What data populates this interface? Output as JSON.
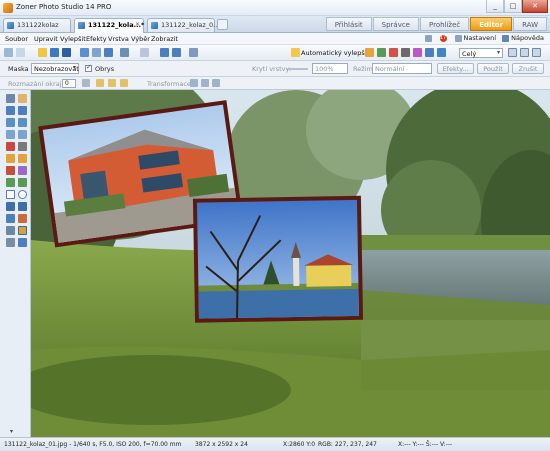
{
  "window": {
    "title": "Zoner Photo Studio 14 PRO",
    "controls": [
      "minimize",
      "maximize",
      "close"
    ]
  },
  "tabs": [
    {
      "label": "131122kolaz",
      "active": false
    },
    {
      "label": "131122_kola...*",
      "active": true
    },
    {
      "label": "131122_kolaz_0...",
      "active": false
    }
  ],
  "modes": [
    "Přihlásit",
    "Správce",
    "Prohlížeč",
    "Editor",
    "RAW"
  ],
  "active_mode": "Editor",
  "menu": {
    "items": [
      "Soubor",
      "Upravit",
      "Vylepšit",
      "Efekty",
      "Vrstva",
      "Výběr",
      "Zobrazit"
    ],
    "notification_count": "17",
    "settings_label": "Nastavení",
    "help_label": "Nápověda"
  },
  "toolbar": {
    "auto_enhance_label": "Automatický vylepšit",
    "zoom_select": "Celý"
  },
  "options": {
    "mask_label": "Maska",
    "mask_value": "Nezobrazovat",
    "outline_label": "Obrys",
    "opacity_label": "Krytí vrstvy:",
    "opacity_value": "100%",
    "mode_label": "Režim:",
    "mode_value": "Normální",
    "effects_button": "Efekty...",
    "apply_button": "Použít",
    "discard_button": "Zrušit",
    "blur_label": "Rozmazání okrajů",
    "blur_value": "0",
    "transform_label": "Transformace"
  },
  "status": {
    "file_info": "131122_kolaz_01.jpg - 1/640 s, F5.0, ISO 200, f=70.00 mm",
    "dimensions": "3872 x 2592 x 24",
    "coords": "X:2860 Y:0",
    "rgb": "RGB: 227, 237, 247",
    "extra": "X:--- Y:--- Š:--- V:---"
  },
  "colors": {
    "accent": "#f09a14",
    "titlebar": "#e3ebf5",
    "panel": "#e8eef5"
  }
}
